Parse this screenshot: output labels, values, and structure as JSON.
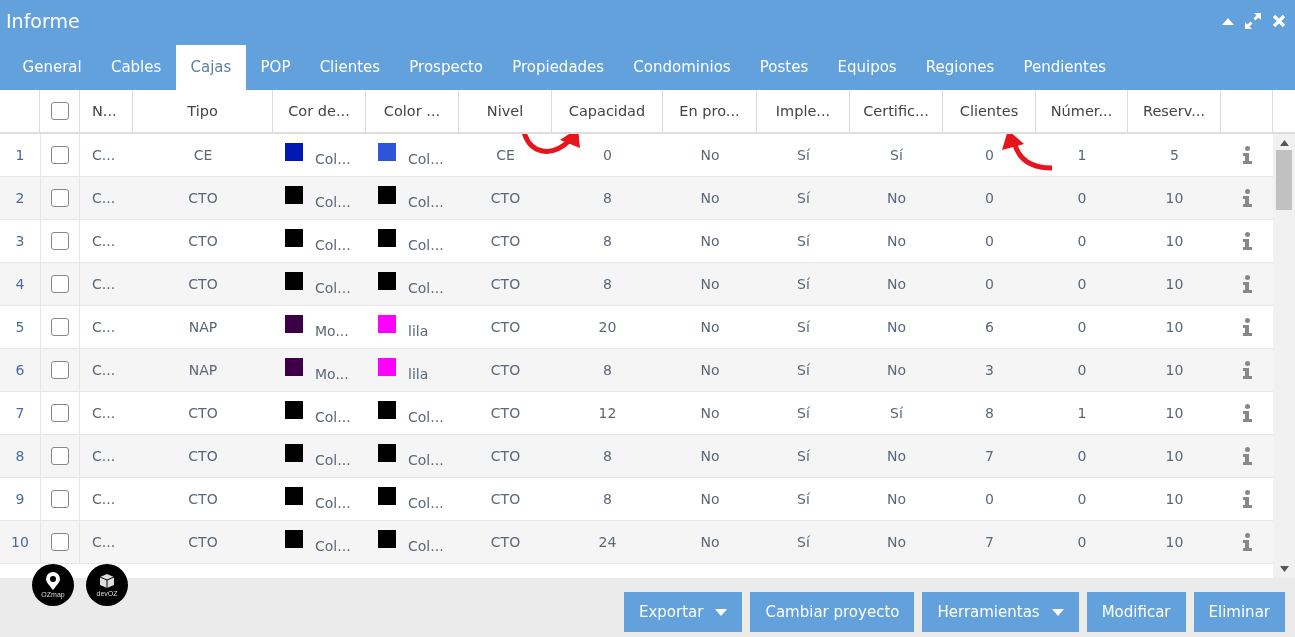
{
  "window": {
    "title": "Informe"
  },
  "tabs": [
    {
      "label": "General",
      "selected": false
    },
    {
      "label": "Cables",
      "selected": false
    },
    {
      "label": "Cajas",
      "selected": true
    },
    {
      "label": "POP",
      "selected": false
    },
    {
      "label": "Clientes",
      "selected": false
    },
    {
      "label": "Prospecto",
      "selected": false
    },
    {
      "label": "Propiedades",
      "selected": false
    },
    {
      "label": "Condominios",
      "selected": false
    },
    {
      "label": "Postes",
      "selected": false
    },
    {
      "label": "Equipos",
      "selected": false
    },
    {
      "label": "Regiones",
      "selected": false
    },
    {
      "label": "Pendientes",
      "selected": false
    }
  ],
  "table": {
    "all_checked": false,
    "columns": [
      "N...",
      "Tipo",
      "Cor de...",
      "Color ...",
      "Nivel",
      "Capacidad",
      "En pro...",
      "Imple...",
      "Certific...",
      "Clientes",
      "Númer...",
      "Reserv..."
    ],
    "rows": [
      {
        "index": "1",
        "checked": false,
        "name": "C...",
        "tipo": "CE",
        "cor": {
          "color": "#0019b5",
          "text": "Col..."
        },
        "color_col": {
          "color": "#2e55d9",
          "text": "Col..."
        },
        "nivel": "CE",
        "capacidad": "0",
        "en_pro": "No",
        "imple": "Sí",
        "certific": "Sí",
        "clientes": "0",
        "numero": "1",
        "reserv": "5"
      },
      {
        "index": "2",
        "checked": false,
        "name": "C...",
        "tipo": "CTO",
        "cor": {
          "color": "#000000",
          "text": "Col..."
        },
        "color_col": {
          "color": "#000000",
          "text": "Col..."
        },
        "nivel": "CTO",
        "capacidad": "8",
        "en_pro": "No",
        "imple": "Sí",
        "certific": "No",
        "clientes": "0",
        "numero": "0",
        "reserv": "10"
      },
      {
        "index": "3",
        "checked": false,
        "name": "C...",
        "tipo": "CTO",
        "cor": {
          "color": "#000000",
          "text": "Col..."
        },
        "color_col": {
          "color": "#000000",
          "text": "Col..."
        },
        "nivel": "CTO",
        "capacidad": "8",
        "en_pro": "No",
        "imple": "Sí",
        "certific": "No",
        "clientes": "0",
        "numero": "0",
        "reserv": "10"
      },
      {
        "index": "4",
        "checked": false,
        "name": "C...",
        "tipo": "CTO",
        "cor": {
          "color": "#000000",
          "text": "Col..."
        },
        "color_col": {
          "color": "#000000",
          "text": "Col..."
        },
        "nivel": "CTO",
        "capacidad": "8",
        "en_pro": "No",
        "imple": "Sí",
        "certific": "No",
        "clientes": "0",
        "numero": "0",
        "reserv": "10"
      },
      {
        "index": "5",
        "checked": false,
        "name": "C...",
        "tipo": "NAP",
        "cor": {
          "color": "#3d0047",
          "text": "Mo..."
        },
        "color_col": {
          "color": "#ff00ff",
          "text": "lila"
        },
        "nivel": "CTO",
        "capacidad": "20",
        "en_pro": "No",
        "imple": "Sí",
        "certific": "No",
        "clientes": "6",
        "numero": "0",
        "reserv": "10"
      },
      {
        "index": "6",
        "checked": false,
        "name": "C...",
        "tipo": "NAP",
        "cor": {
          "color": "#3d0047",
          "text": "Mo..."
        },
        "color_col": {
          "color": "#ff00ff",
          "text": "lila"
        },
        "nivel": "CTO",
        "capacidad": "8",
        "en_pro": "No",
        "imple": "Sí",
        "certific": "No",
        "clientes": "3",
        "numero": "0",
        "reserv": "10"
      },
      {
        "index": "7",
        "checked": false,
        "name": "C...",
        "tipo": "CTO",
        "cor": {
          "color": "#000000",
          "text": "Col..."
        },
        "color_col": {
          "color": "#000000",
          "text": "Col..."
        },
        "nivel": "CTO",
        "capacidad": "12",
        "en_pro": "No",
        "imple": "Sí",
        "certific": "Sí",
        "clientes": "8",
        "numero": "1",
        "reserv": "10"
      },
      {
        "index": "8",
        "checked": false,
        "name": "C...",
        "tipo": "CTO",
        "cor": {
          "color": "#000000",
          "text": "Col..."
        },
        "color_col": {
          "color": "#000000",
          "text": "Col..."
        },
        "nivel": "CTO",
        "capacidad": "8",
        "en_pro": "No",
        "imple": "Sí",
        "certific": "No",
        "clientes": "7",
        "numero": "0",
        "reserv": "10"
      },
      {
        "index": "9",
        "checked": false,
        "name": "C...",
        "tipo": "CTO",
        "cor": {
          "color": "#000000",
          "text": "Col..."
        },
        "color_col": {
          "color": "#000000",
          "text": "Col..."
        },
        "nivel": "CTO",
        "capacidad": "8",
        "en_pro": "No",
        "imple": "Sí",
        "certific": "No",
        "clientes": "0",
        "numero": "0",
        "reserv": "10"
      },
      {
        "index": "10",
        "checked": false,
        "name": "C...",
        "tipo": "CTO",
        "cor": {
          "color": "#000000",
          "text": "Col..."
        },
        "color_col": {
          "color": "#000000",
          "text": "Col..."
        },
        "nivel": "CTO",
        "capacidad": "24",
        "en_pro": "No",
        "imple": "Sí",
        "certific": "No",
        "clientes": "7",
        "numero": "0",
        "reserv": "10"
      }
    ]
  },
  "logos": [
    "OZmap",
    "devOZ"
  ],
  "buttons": [
    {
      "label": "Exportar",
      "dropdown": true
    },
    {
      "label": "Cambiar proyecto",
      "dropdown": false
    },
    {
      "label": "Herramientas",
      "dropdown": true
    },
    {
      "label": "Modificar",
      "dropdown": false
    },
    {
      "label": "Eliminar",
      "dropdown": false
    }
  ]
}
